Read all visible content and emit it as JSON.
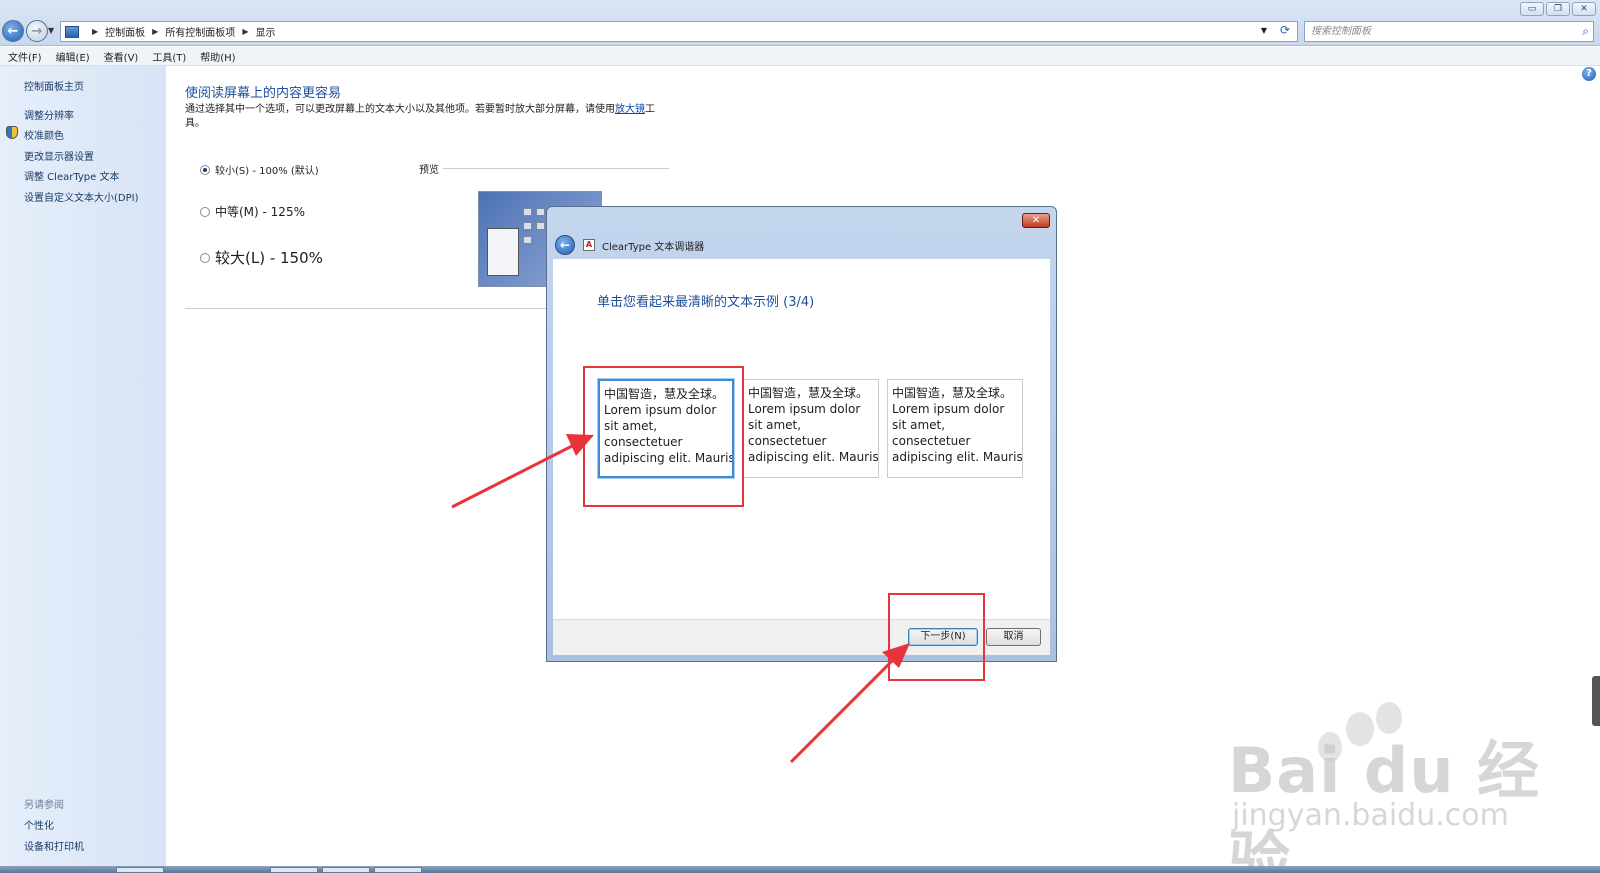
{
  "window": {
    "breadcrumbs": [
      "控制面板",
      "所有控制面板项",
      "显示"
    ],
    "search_placeholder": "搜索控制面板",
    "controls": [
      "minimize-icon",
      "restore-icon",
      "close-icon"
    ]
  },
  "menu": [
    "文件(F)",
    "编辑(E)",
    "查看(V)",
    "工具(T)",
    "帮助(H)"
  ],
  "sidebar": {
    "home": "控制面板主页",
    "links": [
      "调整分辨率",
      "校准颜色",
      "更改显示器设置",
      "调整 ClearType 文本",
      "设置自定义文本大小(DPI)"
    ],
    "see_also_heading": "另请参阅",
    "see_also": [
      "个性化",
      "设备和打印机"
    ]
  },
  "main": {
    "title": "使阅读屏幕上的内容更容易",
    "desc_before": "通过选择其中一个选项，可以更改屏幕上的文本大小以及其他项。若要暂时放大部分屏幕，请使用",
    "desc_link": "放大镜",
    "desc_after": "工具。",
    "options": [
      {
        "label": "较小(S) - 100% (默认)",
        "checked": true
      },
      {
        "label": "中等(M) - 125%",
        "checked": false
      },
      {
        "label": "较大(L) - 150%",
        "checked": false
      }
    ],
    "preview_label": "预览"
  },
  "dialog": {
    "title": "ClearType 文本调谐器",
    "heading": "单击您看起来最清晰的文本示例 (3/4)",
    "samples": [
      {
        "lines": [
          "中国智造，慧及全球。",
          "Lorem ipsum dolor",
          "sit amet,",
          "consectetuer",
          "adipiscing elit. Mauris"
        ],
        "selected": true
      },
      {
        "lines": [
          "中国智造，慧及全球。",
          "Lorem ipsum dolor",
          "sit amet,",
          "consectetuer",
          "adipiscing elit. Mauris"
        ],
        "selected": false
      },
      {
        "lines": [
          "中国智造，慧及全球。",
          "Lorem ipsum dolor",
          "sit amet,",
          "consectetuer",
          "adipiscing elit. Mauris"
        ],
        "selected": false
      }
    ],
    "next_label": "下一步(N)",
    "cancel_label": "取消"
  },
  "watermark": {
    "logo": "Bai du 经验",
    "url": "jingyan.baidu.com"
  },
  "colors": {
    "accent_blue": "#1f4e9b",
    "annotation_red": "#e8333a",
    "selection_blue": "#3b8ad3"
  }
}
